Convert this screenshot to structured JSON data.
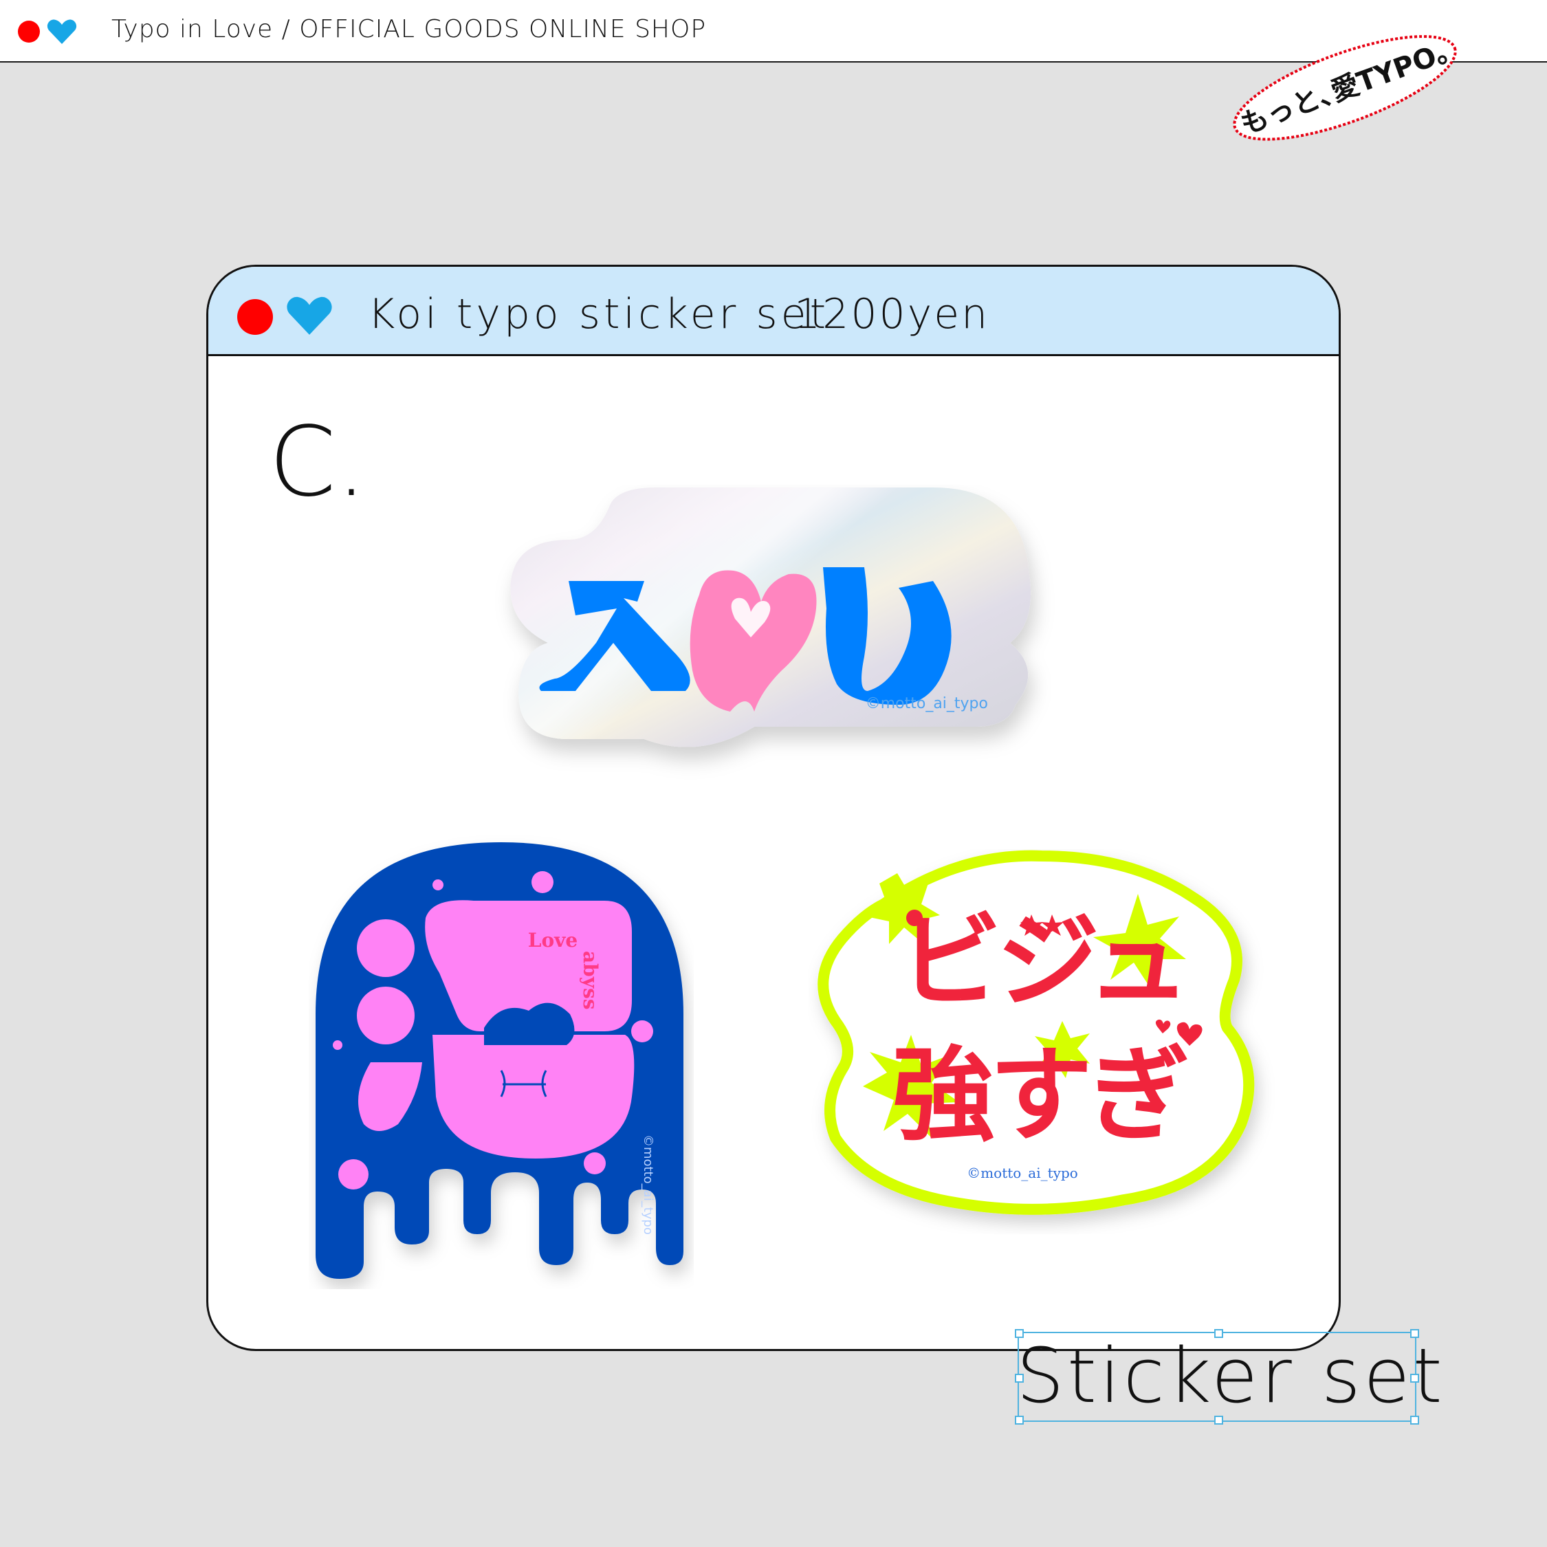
{
  "header": {
    "title": "Typo in Love / OFFICIAL GOODS ONLINE SHOP"
  },
  "stamp": {
    "text": "もっと､愛TYPO｡"
  },
  "product": {
    "name": "Koi typo sticker set",
    "price": "1200yen",
    "variant": "C."
  },
  "stickers": [
    {
      "text": "恋",
      "credit": "©motto_ai_typo"
    },
    {
      "text": "沼",
      "sub1": "Love",
      "sub2": "abyss",
      "credit": "©motto_ai_typo"
    },
    {
      "line1": "ビジュ",
      "line2": "強すぎ",
      "credit": "©motto_ai_typo"
    }
  ],
  "label": {
    "text": "Sticker set"
  },
  "colors": {
    "red": "#ff0000",
    "heart_blue": "#17a6e6",
    "card_header": "#cce8fb",
    "numa_blue": "#0049b7",
    "numa_pink": "#ff82f5",
    "bijyu_lime": "#d5ff00",
    "bijyu_red": "#f0243c",
    "koi_blue": "#0080ff",
    "koi_pink": "#ff85bf"
  }
}
